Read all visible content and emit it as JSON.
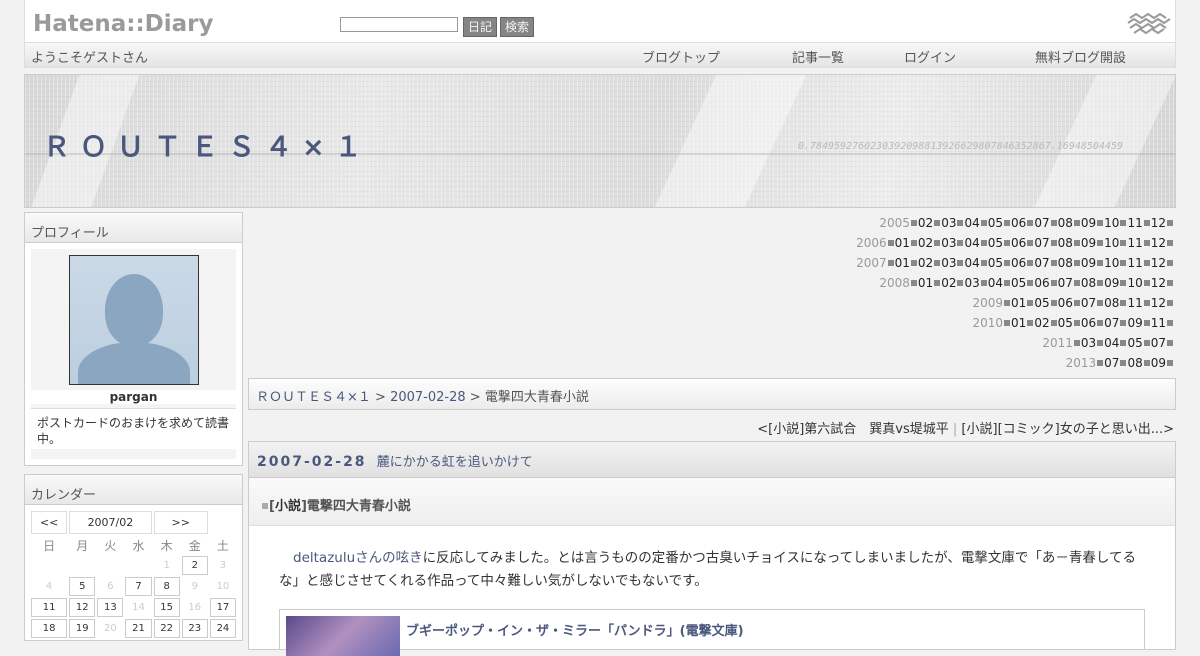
{
  "header": {
    "logo": "Hatena::Diary",
    "search_placeholder": "",
    "btn_diary": "日記",
    "btn_search": "検索"
  },
  "nav": {
    "welcome": "ようこそゲストさん",
    "links": [
      "ブログトップ",
      "記事一覧",
      "ログイン",
      "無料ブログ開設"
    ]
  },
  "banner": {
    "title": "ＲＯＵＴＥＳ４×１",
    "deco_number": "0.7849592760230392098813926629807846352867.16948504459"
  },
  "sidebar": {
    "profile_heading": "プロフィール",
    "profile_name": "pargan",
    "profile_desc": "ポストカードのおまけを求めて読書中。",
    "calendar_heading": "カレンダー",
    "cal_prev": "<<",
    "cal_month": "2007/02",
    "cal_next": ">>",
    "weekdays": [
      "日",
      "月",
      "火",
      "水",
      "木",
      "金",
      "土"
    ],
    "weeks": [
      [
        "",
        "",
        "",
        "",
        "1",
        "2",
        "3"
      ],
      [
        "4",
        "5",
        "6",
        "7",
        "8",
        "9",
        "10"
      ],
      [
        "11",
        "12",
        "13",
        "14",
        "15",
        "16",
        "17"
      ],
      [
        "18",
        "19",
        "20",
        "21",
        "22",
        "23",
        "24"
      ]
    ],
    "active_days": [
      "2",
      "5",
      "7",
      "8",
      "11",
      "12",
      "13",
      "15",
      "17",
      "18",
      "19",
      "21",
      "22",
      "23",
      "24"
    ]
  },
  "archive": [
    {
      "year": "2005",
      "months": [
        "02",
        "03",
        "04",
        "05",
        "06",
        "07",
        "08",
        "09",
        "10",
        "11",
        "12"
      ]
    },
    {
      "year": "2006",
      "months": [
        "01",
        "02",
        "03",
        "04",
        "05",
        "06",
        "07",
        "08",
        "09",
        "10",
        "11",
        "12"
      ]
    },
    {
      "year": "2007",
      "months": [
        "01",
        "02",
        "03",
        "04",
        "05",
        "06",
        "07",
        "08",
        "09",
        "10",
        "11",
        "12"
      ]
    },
    {
      "year": "2008",
      "months": [
        "01",
        "02",
        "03",
        "04",
        "05",
        "06",
        "07",
        "08",
        "09",
        "10",
        "12"
      ]
    },
    {
      "year": "2009",
      "months": [
        "01",
        "05",
        "06",
        "07",
        "08",
        "11",
        "12"
      ]
    },
    {
      "year": "2010",
      "months": [
        "01",
        "02",
        "05",
        "06",
        "07",
        "09",
        "11"
      ]
    },
    {
      "year": "2011",
      "months": [
        "03",
        "04",
        "05",
        "07"
      ]
    },
    {
      "year": "2013",
      "months": [
        "07",
        "08",
        "09"
      ]
    }
  ],
  "breadcrumb": {
    "blog": "ＲＯＵＴＥＳ４×１",
    "sep": ">",
    "date": "2007-02-28",
    "current": "電撃四大青春小説"
  },
  "pager": {
    "prev": "<[小説]第六試合　巽真vs堤城平",
    "sep": "|",
    "next": "[小説][コミック]女の子と思い出...>"
  },
  "entry": {
    "date": "2007-02-28",
    "day_title": "麓にかかる虹を追いかけて",
    "category_open": "[",
    "category": "小説",
    "category_close": "]",
    "section_title": "電撃四大青春小説",
    "link_text": "deltazuluさんの呟き",
    "body_text": "に反応してみました。とは言うものの定番かつ古臭いチョイスになってしまいましたが、電撃文庫で「あ－青春してるな」と感じさせてくれる作品って中々難しい気がしないでもないです。",
    "book_title": "ブギーポップ・イン・ザ・ミラー「パンドラ」(電撃文庫)"
  }
}
